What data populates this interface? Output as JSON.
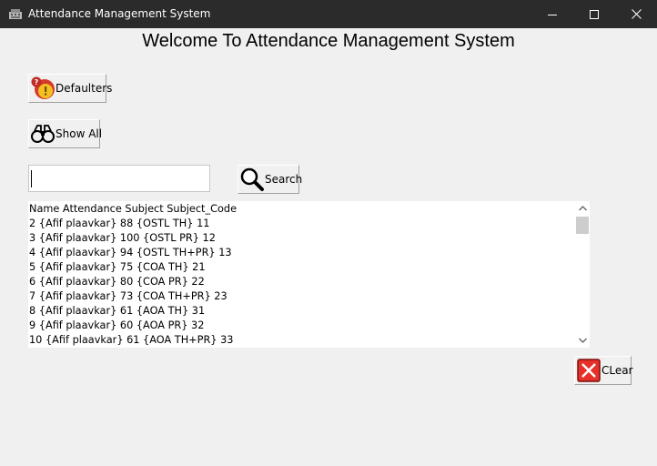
{
  "window": {
    "title": "Attendance Management System",
    "icons": {
      "app": "app-icon",
      "minimize": "minimize-icon",
      "maximize": "maximize-icon",
      "close": "close-icon"
    }
  },
  "main": {
    "heading": "Welcome To Attendance Management System",
    "defaulters_label": "Defaulters",
    "show_all_label": "Show All",
    "search_label": "Search",
    "search_value": "",
    "clear_label": "CLear"
  },
  "list": {
    "items": [
      "Name Attendance Subject Subject_Code",
      "2 {Afif plaavkar} 88 {OSTL TH} 11",
      "3 {Afif plaavkar} 100 {OSTL PR} 12",
      "4 {Afif plaavkar} 94 {OSTL TH+PR} 13",
      "5 {Afif plaavkar} 75 {COA TH} 21",
      "6 {Afif plaavkar} 80 {COA PR} 22",
      "7 {Afif plaavkar} 73 {COA TH+PR} 23",
      "8 {Afif plaavkar} 61 {AOA TH} 31",
      "9 {Afif plaavkar} 60 {AOA PR} 32",
      "10 {Afif plaavkar} 61 {AOA TH+PR} 33"
    ]
  },
  "colors": {
    "titlebar": "#2b2b2b",
    "window_bg": "#f0f0f0",
    "clear_icon": "#e8302a",
    "thumb": "#cdcdcd"
  },
  "icon_names": {
    "defaulters": "warning-alert-icon",
    "show_all": "binoculars-icon",
    "search": "magnifier-icon",
    "clear": "red-x-icon"
  }
}
